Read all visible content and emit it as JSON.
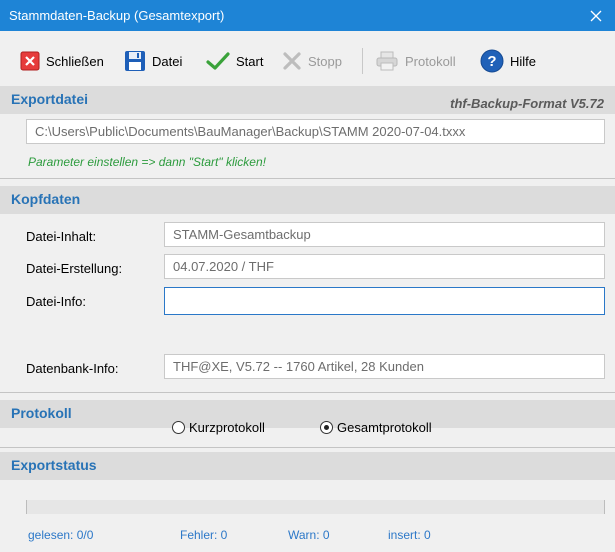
{
  "window": {
    "title": "Stammdaten-Backup (Gesamtexport)"
  },
  "toolbar": {
    "close_label": "Schließen",
    "file_label": "Datei",
    "start_label": "Start",
    "stop_label": "Stopp",
    "log_label": "Protokoll",
    "help_label": "Hilfe"
  },
  "export": {
    "heading": "Exportdatei",
    "format": "thf-Backup-Format V5.72",
    "path": "C:\\Users\\Public\\Documents\\BauManager\\Backup\\STAMM 2020-07-04.txxx",
    "hint": "Parameter einstellen => dann \"Start\" klicken!"
  },
  "header": {
    "heading": "Kopfdaten",
    "content_label": "Datei-Inhalt:",
    "content_value": "STAMM-Gesamtbackup",
    "created_label": "Datei-Erstellung:",
    "created_value": "04.07.2020 / THF",
    "info_label": "Datei-Info:",
    "info_value": "",
    "db_label": "Datenbank-Info:",
    "db_value": "THF@XE, V5.72 -- 1760 Artikel, 28 Kunden"
  },
  "protocol": {
    "heading": "Protokoll",
    "options": [
      "Kurzprotokoll",
      "Gesamtprotokoll"
    ],
    "selected": "Gesamtprotokoll"
  },
  "exportstatus": {
    "heading": "Exportstatus",
    "progress": 0,
    "read": "gelesen: 0/0",
    "errors": "Fehler: 0",
    "warnings": "Warn: 0",
    "insert": "insert: 0"
  },
  "colors": {
    "titlebar": "#1e84d6",
    "section_heading": "#2873b6",
    "hint": "#2c9b3d",
    "status": "#2c78c8"
  }
}
